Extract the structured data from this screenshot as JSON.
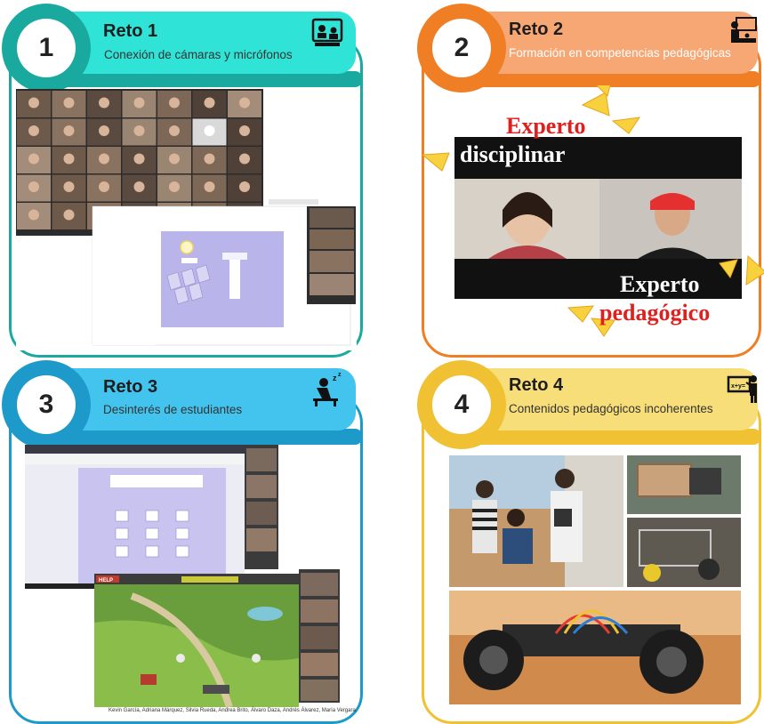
{
  "challenges": [
    {
      "number": "1",
      "title": "Reto 1",
      "subtitle": "Conexión de cámaras y micrófonos",
      "icon": "video-call-icon"
    },
    {
      "number": "2",
      "title": "Reto 2",
      "subtitle": "Formación en competencias pedagógicas",
      "icon": "teacher-board-icon"
    },
    {
      "number": "3",
      "title": "Reto 3",
      "subtitle": "Desinterés de estudiantes",
      "icon": "sleeping-student-icon"
    },
    {
      "number": "4",
      "title": "Reto 4",
      "subtitle": "Contenidos pedagógicos incoherentes",
      "icon": "teacher-equation-icon"
    }
  ],
  "panel2": {
    "top_red": "Experto",
    "top_white": "disciplinar",
    "bottom_white": "Experto",
    "bottom_red": "pedagógico"
  },
  "panel3": {
    "caption": "Kevin García, Adriana Márquez, Silvia Rueda, Andrea Brito, Álvaro Daza, Andrés Álvarez, María Vergara.",
    "game_help": "HELP"
  },
  "colors": {
    "teal": "#2fe3d6",
    "teal_dark": "#1aa99f",
    "orange": "#f07e24",
    "orange_light": "#f7a774",
    "blue": "#1d9ac9",
    "blue_light": "#43c4ef",
    "yellow": "#f0c233",
    "yellow_light": "#f7de79"
  }
}
